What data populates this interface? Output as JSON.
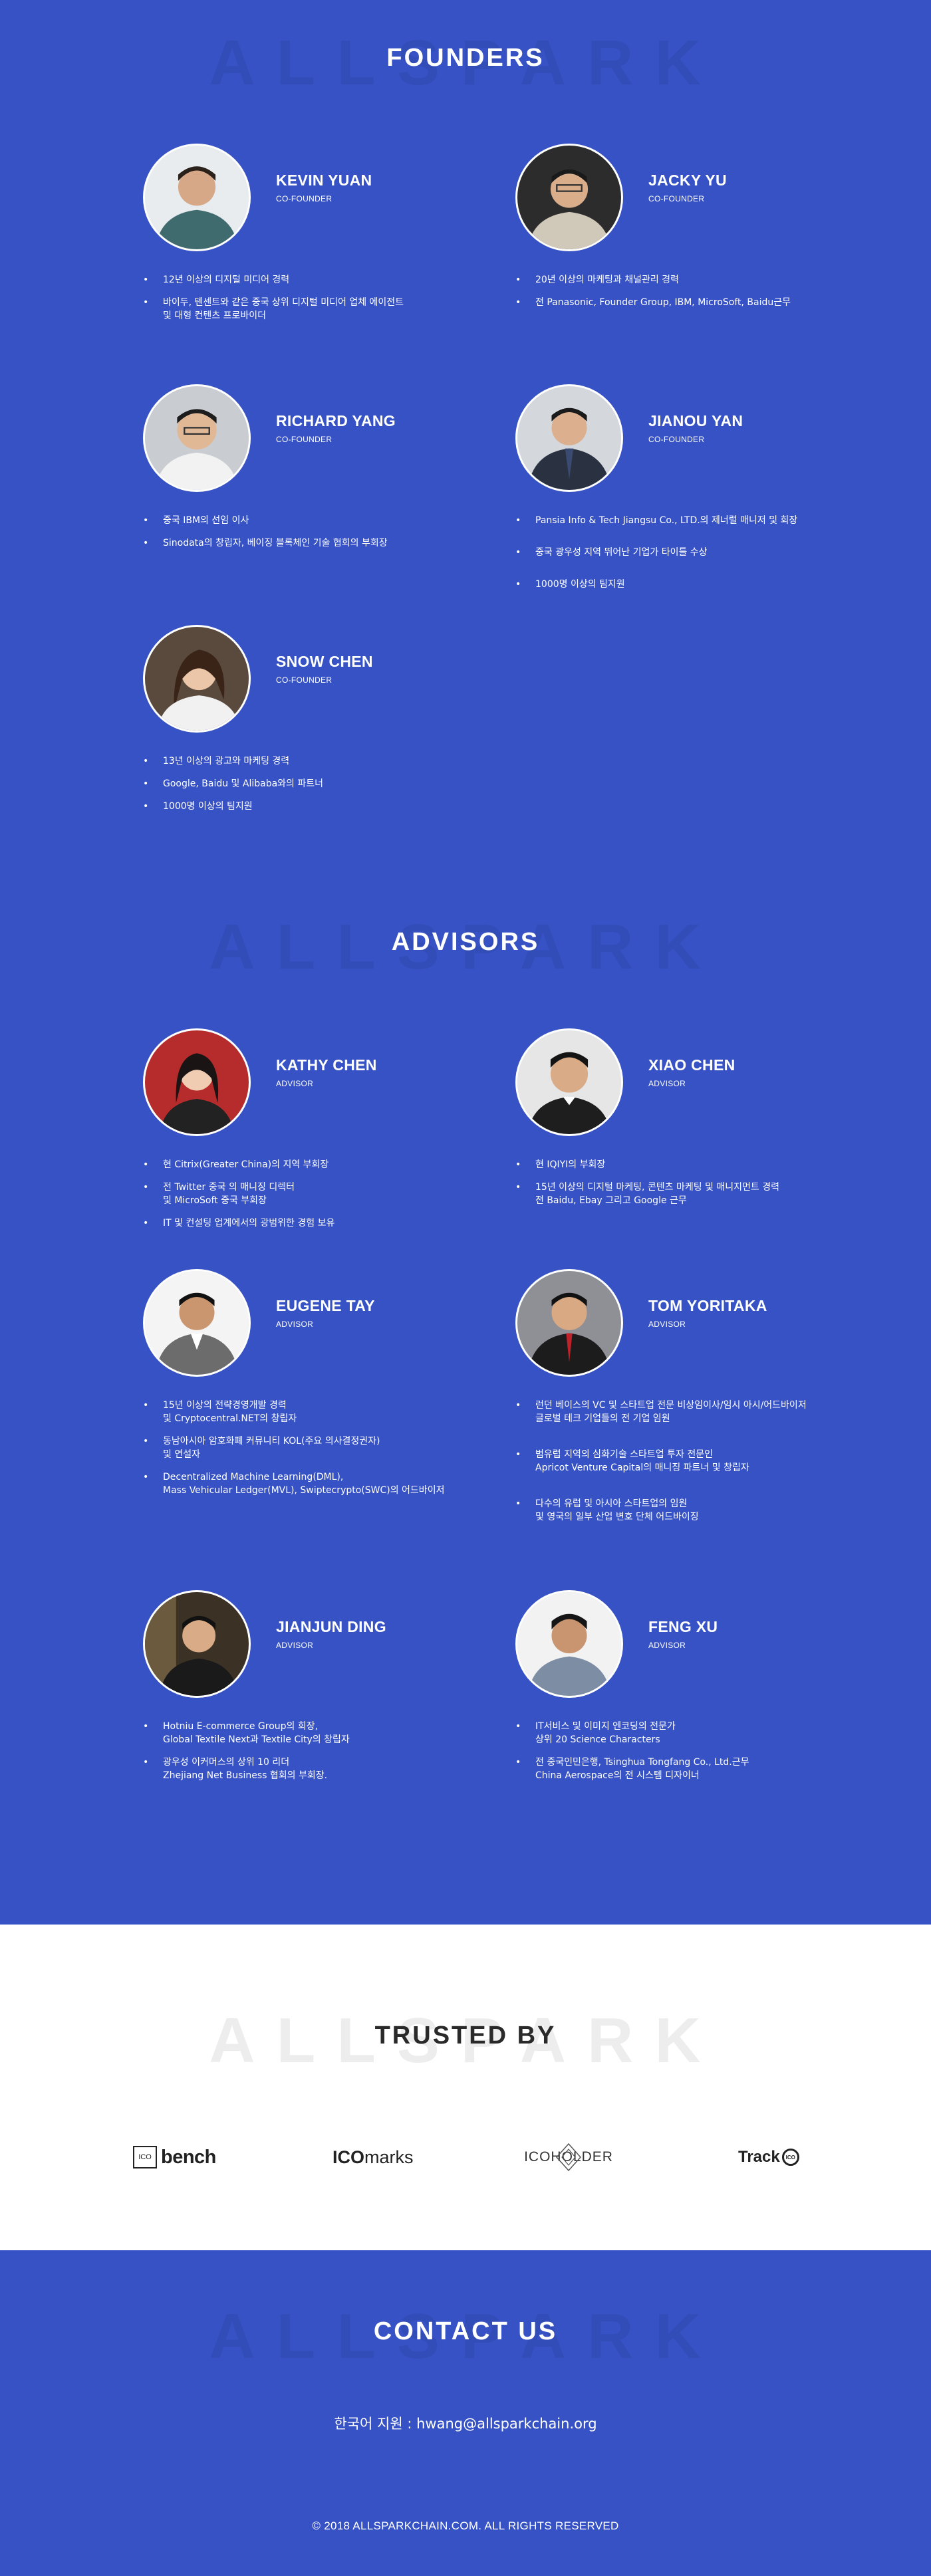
{
  "founders": {
    "watermark": "ALLSPARK",
    "title": "FOUNDERS",
    "people": [
      {
        "name": "KEVIN YUAN",
        "role": "CO-FOUNDER",
        "bullets": [
          "12년 이상의 디지털 미디어 경력",
          "바이두, 텐센트와 같은 중국 상위 디지털 미디어 업체 에이전트\n및 대형 컨텐츠 프로바이더"
        ]
      },
      {
        "name": "JACKY YU",
        "role": "CO-FOUNDER",
        "bullets": [
          "20년 이상의 마케팅과 채널관리 경력",
          "전 Panasonic, Founder Group, IBM, MicroSoft, Baidu근무"
        ]
      },
      {
        "name": "RICHARD YANG",
        "role": "CO-FOUNDER",
        "bullets": [
          "중국 IBM의 선임 이사",
          "Sinodata의 창립자, 베이징 블록체인 기술 협회의 부회장"
        ]
      },
      {
        "name": "JIANOU YAN",
        "role": "CO-FOUNDER",
        "bullets": [
          "Pansia Info & Tech Jiangsu Co., LTD.의 제너럴 매니저 및 회장",
          "중국 광우성 지역 뛰어난 기업가 타이틀 수상",
          "1000명 이상의 팀지원"
        ]
      },
      {
        "name": "SNOW CHEN",
        "role": "CO-FOUNDER",
        "bullets": [
          "13년 이상의 광고와 마케팅 경력",
          "Google, Baidu 및 Alibaba와의 파트너",
          "1000명 이상의 팀지원"
        ]
      }
    ]
  },
  "advisors": {
    "watermark": "ALLSPARK",
    "title": "ADVISORS",
    "people": [
      {
        "name": "KATHY CHEN",
        "role": "ADVISOR",
        "bullets": [
          "현 Citrix(Greater China)의 지역 부회장",
          "전 Twitter 중국 의 매니징 디렉터\n및 MicroSoft 중국 부회장",
          "IT 및 컨설팅 업계에서의 광범위한 경험 보유"
        ]
      },
      {
        "name": "XIAO CHEN",
        "role": "ADVISOR",
        "bullets": [
          "현 IQIYI의 부회장",
          "15년 이상의 디지털 마케팅, 콘텐츠 마케팅 및 매니지먼트 경력\n전 Baidu, Ebay 그리고 Google 근무"
        ]
      },
      {
        "name": "EUGENE TAY",
        "role": "ADVISOR",
        "bullets": [
          "15년 이상의 전략경영개발 경력\n및 Cryptocentral.NET의 창립자",
          "동남아시아 암호화폐 커뮤니티 KOL(주요 의사결정권자)\n및 연설자",
          "Decentralized Machine Learning(DML),\nMass Vehicular Ledger(MVL), Swiptecrypto(SWC)의 어드바이저"
        ]
      },
      {
        "name": "TOM YORITAKA",
        "role": "ADVISOR",
        "bullets": [
          "런던 베이스의 VC 및 스타트업 전문 비상임이사/임시 아시/어드바이저\n글로벌 테크 기업들의 전 기업 임원",
          "범유럽 지역의 심화기술 스타트업 투자 전문인\nApricot Venture Capital의 매니징 파트너 및 창립자",
          "다수의 유럽 및 아시아 스타트업의 임원\n및 영국의 일부 산업 변호 단체 어드바이징"
        ]
      },
      {
        "name": "JIANJUN DING",
        "role": "ADVISOR",
        "bullets": [
          "Hotniu E-commerce Group의 회장,\nGlobal Textile Next과 Textile City의 창립자",
          "광우성 이커머스의 상위 10 리더\nZhejiang Net Business 협회의 부회장."
        ]
      },
      {
        "name": "FENG XU",
        "role": "ADVISOR",
        "bullets": [
          "IT서비스 및 이미지 엔코딩의 전문가\n상위 20 Science Characters",
          "전 중국인민은행, Tsinghua Tongfang Co., Ltd.근무\nChina Aerospace의 전 시스템 디자이너"
        ]
      }
    ]
  },
  "trusted": {
    "watermark": "ALLSPARK",
    "title": "TRUSTED BY",
    "logos": [
      {
        "icon": "icobench-logo",
        "box_text": "ICO",
        "text": "bench"
      },
      {
        "icon": "icomarks-logo",
        "bold_text": "ICO",
        "text": "marks"
      },
      {
        "icon": "icoholder-logo",
        "text": "ICOHOLDER"
      },
      {
        "icon": "trackico-logo",
        "text": "Track",
        "badge": "ICO"
      }
    ]
  },
  "contact": {
    "watermark": "ALLSPARK",
    "title": "CONTACT US",
    "email_line": "한국어 지원 : hwang@allsparkchain.org",
    "copyright": "© 2018 ALLSPARKCHAIN.COM. ALL RIGHTS RESERVED"
  },
  "colors": {
    "primary_blue": "#3652c4",
    "white": "#ffffff",
    "dark_text": "#2a2a2a"
  }
}
